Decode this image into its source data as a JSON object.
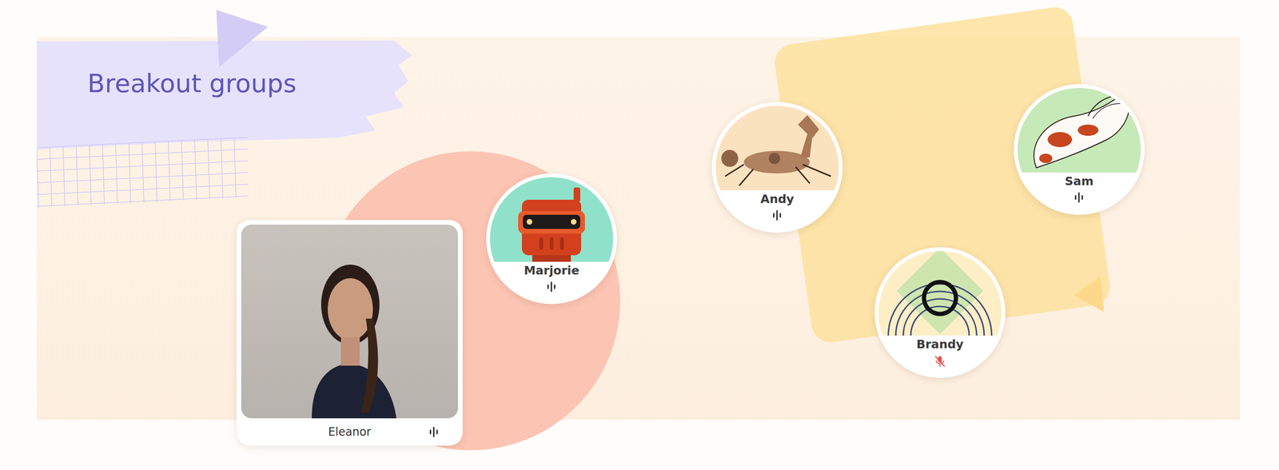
{
  "title": "Breakout groups",
  "groups": [
    {
      "color": "#fcc4b3",
      "participants": [
        {
          "name": "Eleanor",
          "kind": "video",
          "muted": false
        },
        {
          "name": "Marjorie",
          "kind": "robot",
          "muted": false
        }
      ]
    },
    {
      "color": "#fde19c",
      "participants": [
        {
          "name": "Andy",
          "kind": "horse",
          "muted": false
        },
        {
          "name": "Sam",
          "kind": "koi",
          "muted": false
        },
        {
          "name": "Brandy",
          "kind": "rings",
          "muted": true
        }
      ]
    }
  ]
}
